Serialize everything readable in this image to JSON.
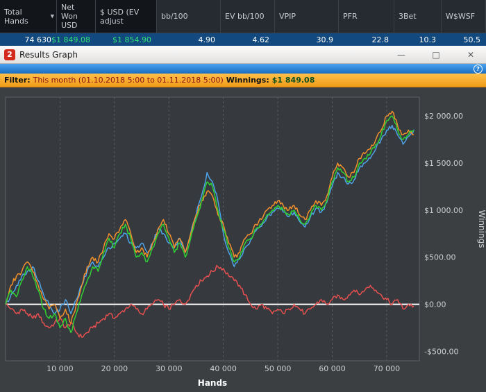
{
  "stats": {
    "headers": [
      {
        "label": "Total Hands",
        "dropdown": true
      },
      {
        "label": "Net Won USD"
      },
      {
        "label": "$ USD (EV adjust"
      },
      {
        "label": "bb/100"
      },
      {
        "label": "EV bb/100"
      },
      {
        "label": "VPIP"
      },
      {
        "label": "PFR"
      },
      {
        "label": "3Bet"
      },
      {
        "label": "W$WSF"
      }
    ],
    "values": [
      "74 630",
      "$1 849.08",
      "$1 854.90",
      "4.90",
      "4.62",
      "30.9",
      "22.8",
      "10.3",
      "50.5"
    ],
    "money_indices": [
      1,
      2
    ]
  },
  "window": {
    "title": "Results Graph",
    "icon_glyph": "2",
    "minimize_glyph": "—",
    "maximize_glyph": "□",
    "close_glyph": "✕",
    "help_glyph": "?"
  },
  "filter_bar": {
    "label": "Filter:",
    "range": "This month (01.10.2018 5:00 to 01.11.2018 5:00)",
    "winnings_label": "Winnings:",
    "winnings_value": "$1 849.08"
  },
  "colors": {
    "money_green": "#35e077",
    "logo_red": "#d42a1e",
    "filter_orange": "#f6a821",
    "stats_row_blue": "#124a7f",
    "zero_line_white": "#ffffff"
  },
  "chart_data": {
    "type": "line",
    "xlabel": "Hands",
    "ylabel": "Winnings",
    "xlim": [
      0,
      76000
    ],
    "ylim": [
      -600,
      2200
    ],
    "x_step": 1000,
    "grid": "vertical-dashed",
    "zero_line": true,
    "legend": "none",
    "x_ticks": [
      {
        "value": 10000,
        "label": "10 000"
      },
      {
        "value": 20000,
        "label": "20 000"
      },
      {
        "value": 30000,
        "label": "30 000"
      },
      {
        "value": 40000,
        "label": "40 000"
      },
      {
        "value": 50000,
        "label": "50 000"
      },
      {
        "value": 60000,
        "label": "60 000"
      },
      {
        "value": 70000,
        "label": "70 000"
      }
    ],
    "y_ticks": [
      {
        "value": 2000,
        "label": "$2 000.00"
      },
      {
        "value": 1500,
        "label": "$1 500.00"
      },
      {
        "value": 1000,
        "label": "$1 000.00"
      },
      {
        "value": 500,
        "label": "$500.00"
      },
      {
        "value": 0,
        "label": "$0.00"
      },
      {
        "value": -500,
        "label": "-$500.00"
      }
    ],
    "series": [
      {
        "name": "red-line",
        "color": "#e65050",
        "values": [
          0,
          -50,
          -100,
          -50,
          -100,
          -150,
          -100,
          -200,
          -250,
          -200,
          -150,
          -250,
          -200,
          -300,
          -350,
          -300,
          -250,
          -200,
          -150,
          -100,
          -150,
          -100,
          -50,
          0,
          -50,
          -100,
          -50,
          0,
          50,
          0,
          -50,
          0,
          50,
          0,
          100,
          200,
          250,
          300,
          350,
          400,
          380,
          300,
          250,
          200,
          100,
          0,
          -50,
          0,
          -50,
          -100,
          -50,
          -100,
          -50,
          0,
          -50,
          -100,
          -50,
          0,
          50,
          0,
          50,
          100,
          50,
          100,
          150,
          100,
          150,
          200,
          150,
          100,
          50,
          0,
          50,
          -50,
          0,
          -20
        ]
      },
      {
        "name": "blue-line",
        "color": "#4da3e8",
        "values": [
          0,
          100,
          200,
          300,
          350,
          400,
          250,
          100,
          0,
          -100,
          -50,
          50,
          -100,
          50,
          200,
          350,
          450,
          400,
          500,
          600,
          650,
          700,
          750,
          650,
          600,
          650,
          550,
          650,
          800,
          750,
          650,
          600,
          700,
          550,
          750,
          950,
          1150,
          1400,
          1300,
          1100,
          750,
          550,
          400,
          480,
          600,
          680,
          780,
          830,
          920,
          980,
          1020,
          980,
          930,
          980,
          880,
          820,
          930,
          1020,
          980,
          1080,
          1250,
          1400,
          1350,
          1280,
          1320,
          1450,
          1500,
          1550,
          1650,
          1750,
          1850,
          1900,
          1800,
          1700,
          1780,
          1855
        ]
      },
      {
        "name": "orange-line",
        "color": "#f2902d",
        "values": [
          0,
          200,
          300,
          350,
          450,
          350,
          200,
          50,
          -50,
          0,
          -150,
          -50,
          -200,
          0,
          200,
          400,
          500,
          450,
          600,
          750,
          700,
          800,
          900,
          750,
          550,
          600,
          500,
          650,
          800,
          900,
          750,
          600,
          700,
          550,
          750,
          950,
          1100,
          1200,
          1150,
          950,
          850,
          650,
          500,
          550,
          700,
          750,
          850,
          900,
          1000,
          1050,
          1100,
          1050,
          1000,
          1050,
          950,
          900,
          1000,
          1100,
          1050,
          1150,
          1350,
          1500,
          1450,
          1350,
          1400,
          1550,
          1600,
          1650,
          1750,
          1850,
          2000,
          2050,
          1900,
          1800,
          1850,
          1800
        ]
      },
      {
        "name": "green-line",
        "color": "#2fd133",
        "values": [
          0,
          150,
          80,
          250,
          400,
          300,
          150,
          -50,
          -150,
          -100,
          -250,
          -150,
          -300,
          -100,
          100,
          250,
          400,
          350,
          550,
          700,
          600,
          750,
          850,
          700,
          500,
          550,
          450,
          600,
          750,
          850,
          700,
          550,
          650,
          500,
          700,
          900,
          1100,
          1300,
          1250,
          1000,
          800,
          600,
          450,
          500,
          650,
          700,
          800,
          850,
          950,
          1000,
          1050,
          1000,
          950,
          1000,
          900,
          850,
          950,
          1050,
          1000,
          1100,
          1300,
          1450,
          1400,
          1300,
          1350,
          1500,
          1550,
          1600,
          1700,
          1800,
          1950,
          2000,
          1850,
          1750,
          1800,
          1849
        ]
      }
    ]
  }
}
